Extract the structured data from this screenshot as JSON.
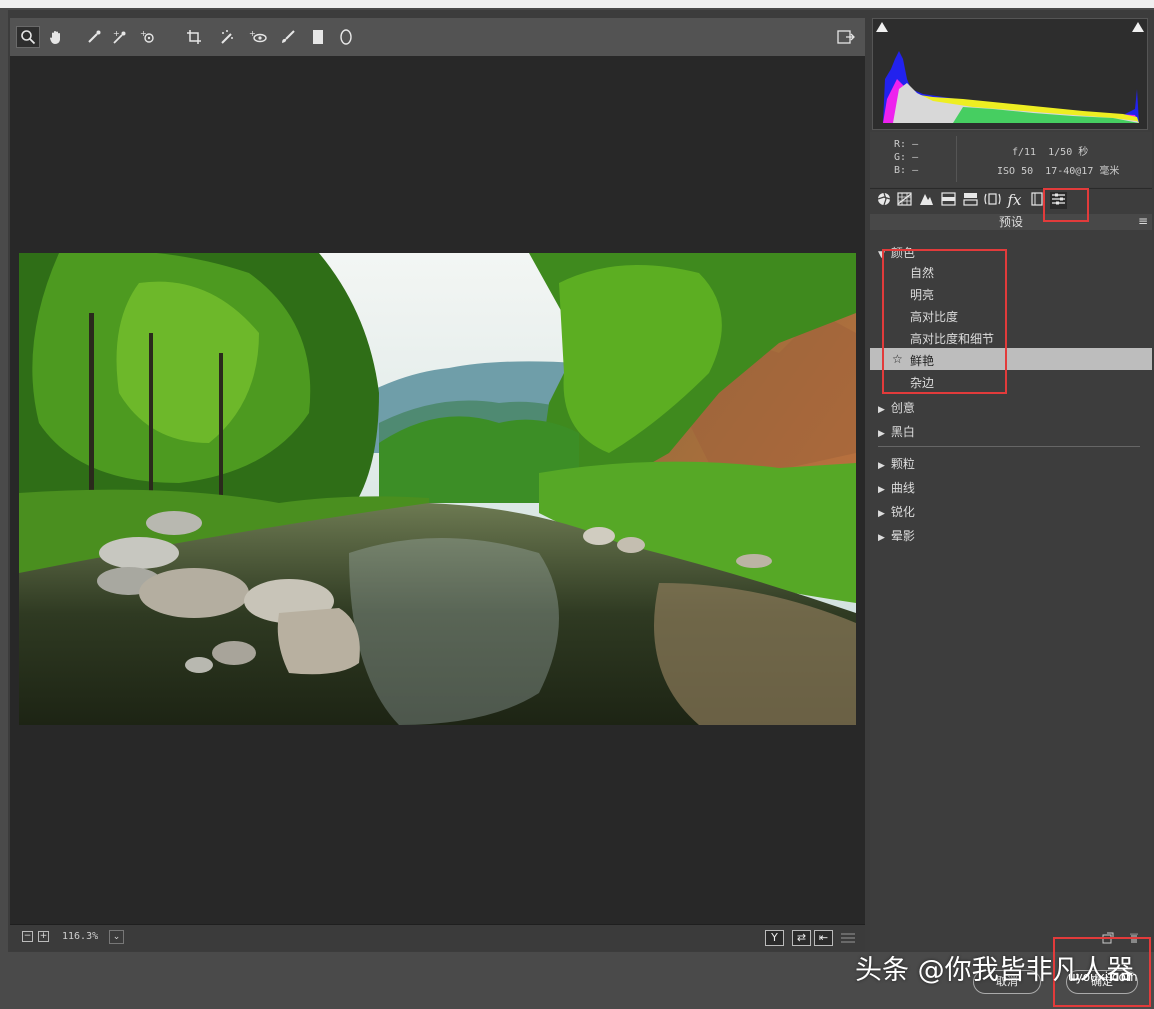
{
  "toolbar": {
    "tools": [
      "zoom-icon",
      "hand-icon",
      "white-balance-icon",
      "color-sampler-icon",
      "targeted-adjust-icon",
      "crop-icon",
      "spot-removal-icon",
      "red-eye-icon",
      "adjustment-brush-icon",
      "graduated-filter-icon",
      "radial-filter-icon"
    ]
  },
  "status": {
    "zoom": "116.3%",
    "zoom_minus": "−",
    "zoom_plus": "+",
    "dropdown": "⌄",
    "before_after": "Y",
    "swap": "⇄",
    "copy": "⇤"
  },
  "info": {
    "r_label": "R:",
    "g_label": "G:",
    "b_label": "B:",
    "r_value": "—",
    "g_value": "—",
    "b_value": "—",
    "aperture": "f/11",
    "shutter": "1/50 秒",
    "iso": "ISO 50",
    "lens": "17-40@17 毫米"
  },
  "panel": {
    "title": "预设",
    "groups": [
      {
        "label": "颜色",
        "expanded": true,
        "items": [
          "自然",
          "明亮",
          "高对比度",
          "高对比度和细节",
          "鲜艳",
          "杂边"
        ],
        "selected": "鲜艳",
        "selected_marker": "☆"
      },
      {
        "label": "创意"
      },
      {
        "label": "黑白"
      },
      {
        "label": "颗粒"
      },
      {
        "label": "曲线"
      },
      {
        "label": "锐化"
      },
      {
        "label": "晕影"
      }
    ]
  },
  "buttons": {
    "cancel": "取消",
    "ok": "确定"
  },
  "watermark": {
    "text": "头条 @你我皆非凡人",
    "site": "uyouxi.com",
    "extra": "器"
  },
  "colors": {
    "highlight_box": "#e23b3b",
    "selected_row": "#bdbdbd"
  }
}
